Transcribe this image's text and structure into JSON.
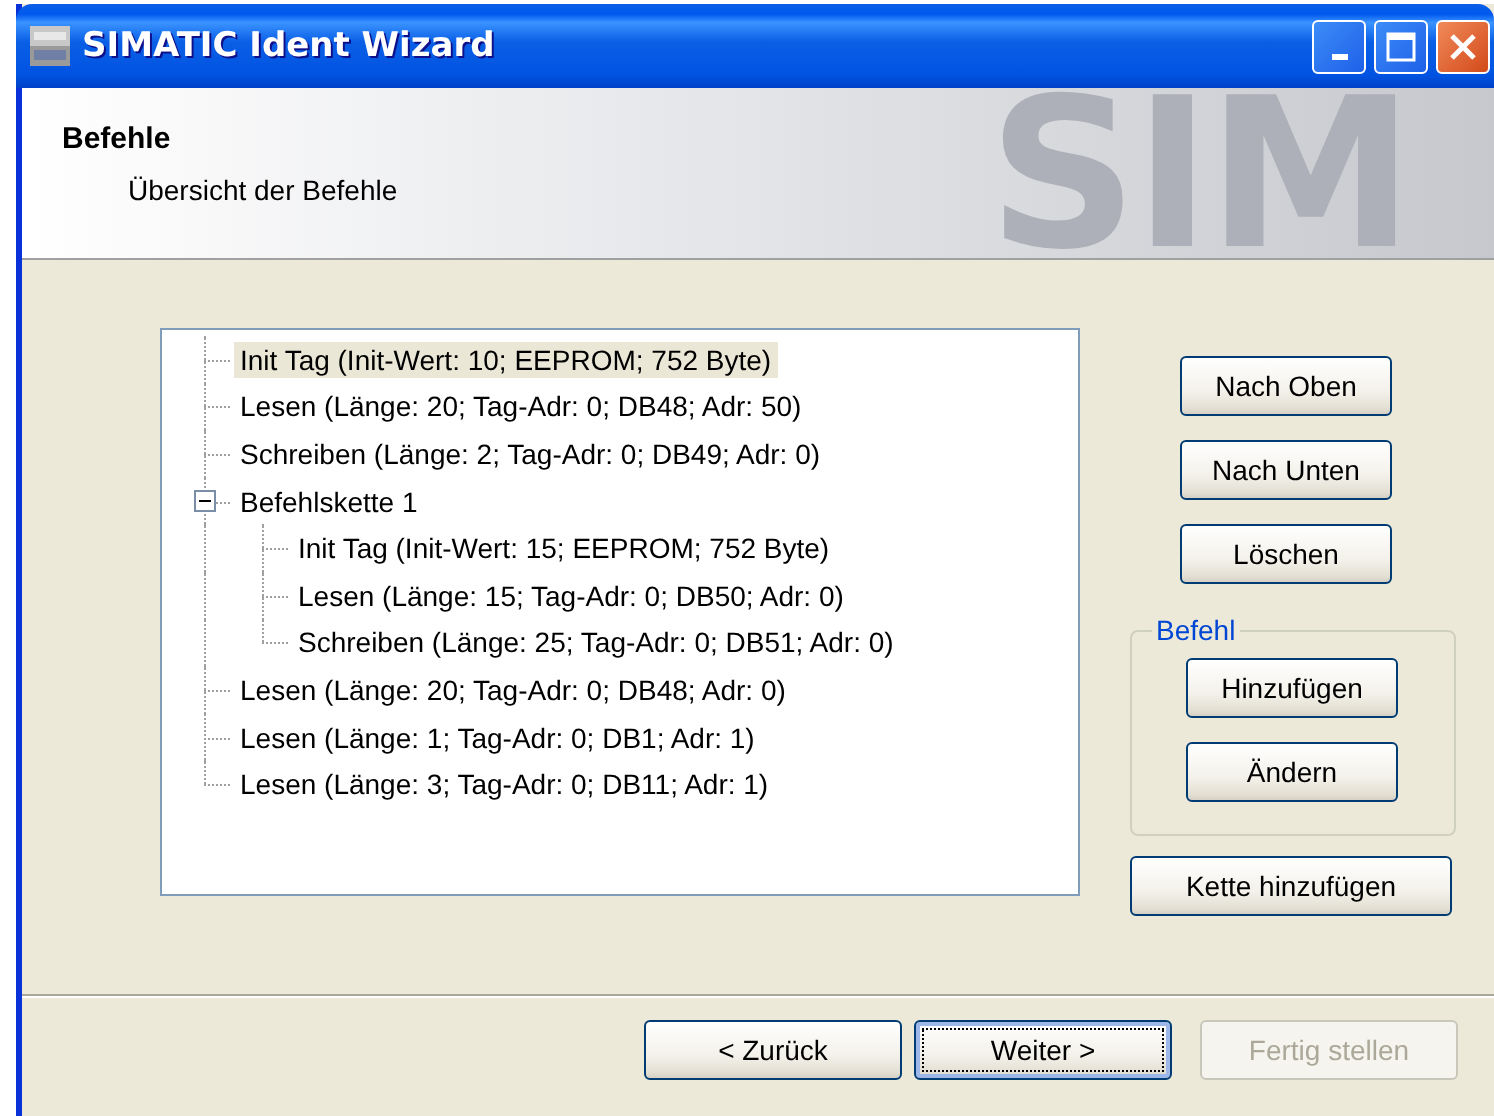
{
  "window": {
    "title": "SIMATIC Ident Wizard"
  },
  "header": {
    "title": "Befehle",
    "subtitle": "Übersicht der Befehle",
    "banner_text": "SIM"
  },
  "tree": {
    "items": [
      {
        "label": "Init Tag (Init-Wert: 10; EEPROM; 752 Byte)",
        "selected": true
      },
      {
        "label": "Lesen (Länge: 20; Tag-Adr: 0; DB48; Adr: 50)",
        "selected": false
      },
      {
        "label": "Schreiben (Länge: 2; Tag-Adr: 0; DB49; Adr: 0)",
        "selected": false
      },
      {
        "label": "Befehlskette 1",
        "selected": false,
        "expanded": true,
        "children": [
          {
            "label": "Init Tag (Init-Wert: 15; EEPROM; 752 Byte)",
            "selected": false
          },
          {
            "label": "Lesen (Länge: 15; Tag-Adr: 0; DB50; Adr: 0)",
            "selected": false
          },
          {
            "label": "Schreiben (Länge: 25; Tag-Adr: 0; DB51; Adr: 0)",
            "selected": false
          }
        ]
      },
      {
        "label": "Lesen (Länge: 20; Tag-Adr: 0; DB48; Adr: 0)",
        "selected": false
      },
      {
        "label": "Lesen (Länge: 1; Tag-Adr: 0; DB1; Adr: 1)",
        "selected": false
      },
      {
        "label": "Lesen (Länge: 3; Tag-Adr: 0; DB11; Adr: 1)",
        "selected": false
      }
    ]
  },
  "side_buttons": [
    {
      "label": "Nach Oben"
    },
    {
      "label": "Nach Unten"
    },
    {
      "label": "Löschen"
    }
  ],
  "group": {
    "title": "Befehl",
    "buttons": [
      {
        "label": "Hinzufügen"
      },
      {
        "label": "Ändern"
      }
    ]
  },
  "chain_button": {
    "label": "Kette hinzufügen"
  },
  "footer_buttons": [
    {
      "label": "< Zurück",
      "default": false,
      "disabled": false
    },
    {
      "label": "Weiter >",
      "default": true,
      "disabled": false
    },
    {
      "label": "Fertig stellen",
      "default": false,
      "disabled": true
    }
  ]
}
